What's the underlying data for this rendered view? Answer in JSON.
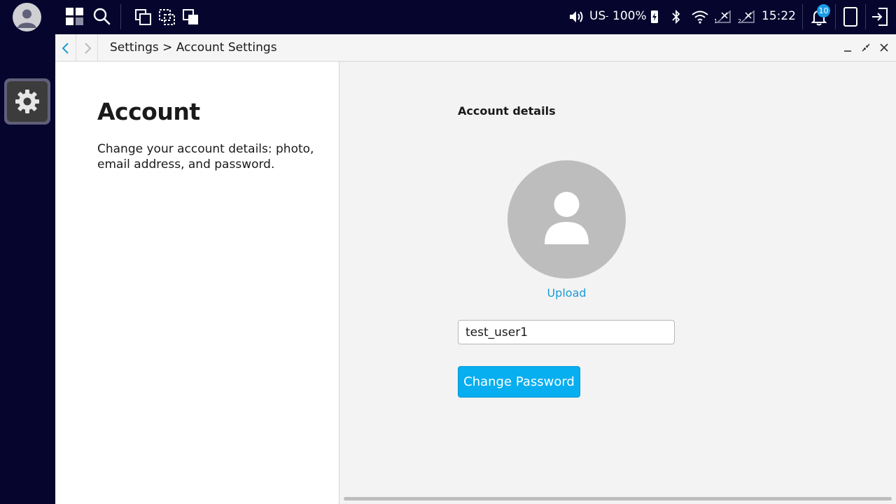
{
  "taskbar": {
    "keyboard_layout": "US",
    "battery_percent": "100%",
    "clock": "15:22",
    "notification_count": "10",
    "icons": [
      "user-avatar-icon",
      "launcher-grid-icon",
      "search-icon",
      "overview-icon",
      "screenshot-region-icon",
      "window-stack-icon",
      "volume-icon",
      "battery-charging-icon",
      "bluetooth-icon",
      "wifi-icon",
      "signal-off-icon",
      "signal-off-icon",
      "bell-icon",
      "tablet-mode-icon",
      "logout-icon"
    ]
  },
  "dock": {
    "items": [
      {
        "name": "Settings",
        "icon": "gear-icon"
      }
    ]
  },
  "window": {
    "breadcrumb": "Settings > Account Settings",
    "left_pane": {
      "title": "Account",
      "description": "Change your account details: photo, email address, and password."
    },
    "right_pane": {
      "section_title": "Account details",
      "upload_label": "Upload",
      "username_value": "test_user1",
      "change_password_label": "Change Password"
    }
  },
  "colors": {
    "panel_bg": "#05052e",
    "accent": "#07aef0",
    "link": "#1a9bd6",
    "badge": "#1a9be6",
    "avatar_placeholder": "#bdbdbd"
  }
}
